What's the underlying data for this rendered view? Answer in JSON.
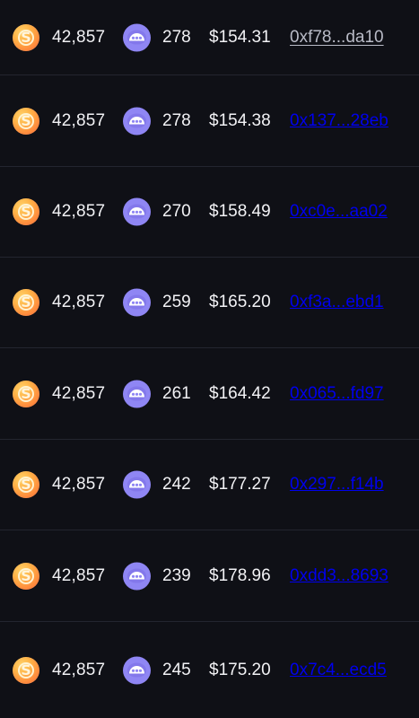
{
  "rows": [
    {
      "amount_a": "42,857",
      "amount_b": "278",
      "price": "$154.31",
      "address": "0xf78...da10",
      "address_style": "link"
    },
    {
      "amount_a": "42,857",
      "amount_b": "278",
      "price": "$154.38",
      "address": "0x137...28eb",
      "address_style": "plain"
    },
    {
      "amount_a": "42,857",
      "amount_b": "270",
      "price": "$158.49",
      "address": "0xc0e...aa02",
      "address_style": "plain"
    },
    {
      "amount_a": "42,857",
      "amount_b": "259",
      "price": "$165.20",
      "address": "0xf3a...ebd1",
      "address_style": "plain"
    },
    {
      "amount_a": "42,857",
      "amount_b": "261",
      "price": "$164.42",
      "address": "0x065...fd97",
      "address_style": "plain"
    },
    {
      "amount_a": "42,857",
      "amount_b": "242",
      "price": "$177.27",
      "address": "0x297...f14b",
      "address_style": "plain"
    },
    {
      "amount_a": "42,857",
      "amount_b": "239",
      "price": "$178.96",
      "address": "0xdd3...8693",
      "address_style": "plain"
    },
    {
      "amount_a": "42,857",
      "amount_b": "245",
      "price": "$175.20",
      "address": "0x7c4...ecd5",
      "address_style": "plain"
    }
  ],
  "icons": {
    "token_a": "orange-s-coin-icon",
    "token_b": "purple-dots-coin-icon"
  },
  "colors": {
    "background": "#0f1016",
    "divider": "#23252f",
    "text": "#f2f2f5",
    "link": "#b9bbc7",
    "token_a_gradient_start": "#ffd36b",
    "token_a_gradient_end": "#f56b3a",
    "token_b": "#8f86f4"
  }
}
